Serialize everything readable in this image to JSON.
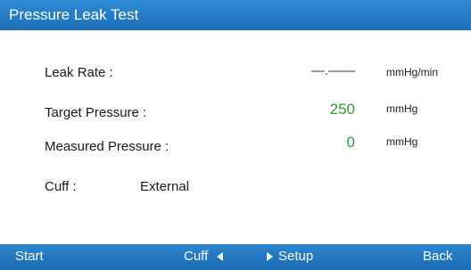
{
  "title": "Pressure Leak Test",
  "fields": {
    "leak_rate": {
      "label": "Leak Rate :",
      "value": "—.——",
      "unit": "mmHg/min"
    },
    "target_pressure": {
      "label": "Target Pressure :",
      "value": "250",
      "unit": "mmHg"
    },
    "measured_pressure": {
      "label": "Measured Pressure :",
      "value": "0",
      "unit": "mmHg"
    },
    "cuff": {
      "label": "Cuff :",
      "value": "External"
    }
  },
  "bottom_bar": {
    "start_label": "Start",
    "cuff_label": "Cuff",
    "setup_label": "Setup",
    "back_label": "Back"
  },
  "icons": {
    "cuff_arrow": "triangle-left-icon",
    "setup_arrow": "triangle-right-icon"
  },
  "colors": {
    "bar_blue": "#1d6fb9",
    "value_green": "#2e9a2e",
    "text": "#1a1a1a"
  }
}
